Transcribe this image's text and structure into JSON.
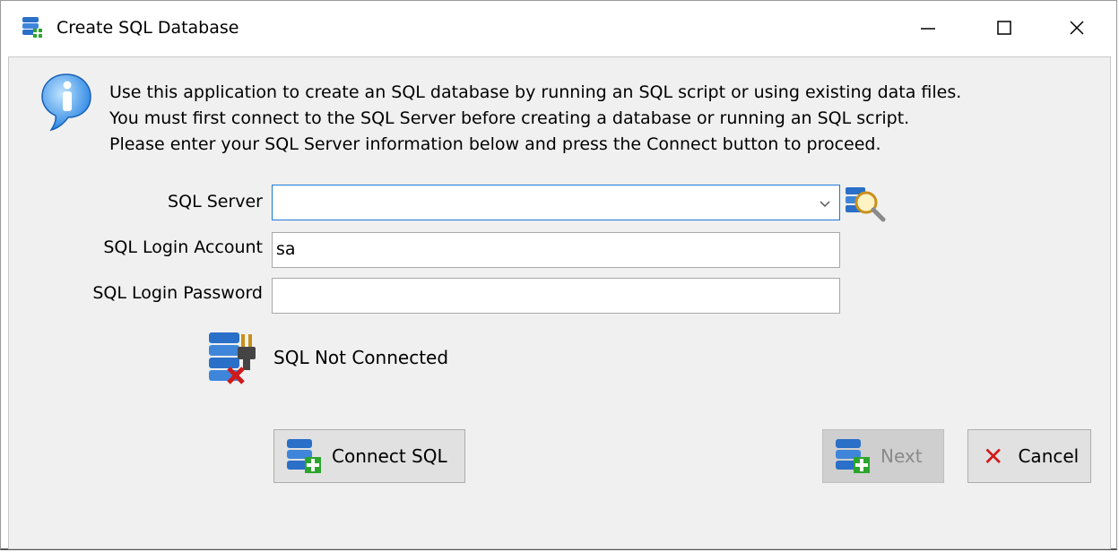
{
  "window": {
    "title": "Create SQL Database",
    "controls": {
      "minimize": "—",
      "maximize": "☐",
      "close": "✕"
    }
  },
  "info": {
    "line1": "Use this application to create an SQL database by running an SQL script or using existing data files.",
    "line2": "You must first connect to the SQL Server before creating a database or running an SQL script.",
    "line3": "Please enter your SQL Server information below and press the Connect button to proceed."
  },
  "form": {
    "server_label": "SQL Server",
    "server_value": "",
    "login_label": "SQL Login Account",
    "login_value": "sa",
    "password_label": "SQL Login Password",
    "password_value": ""
  },
  "status": {
    "text": "SQL Not Connected"
  },
  "buttons": {
    "connect": "Connect SQL",
    "next": "Next",
    "cancel": "Cancel"
  },
  "colors": {
    "accent": "#1d79d8",
    "danger": "#d01a1a",
    "db_blue": "#2a6fc8"
  }
}
